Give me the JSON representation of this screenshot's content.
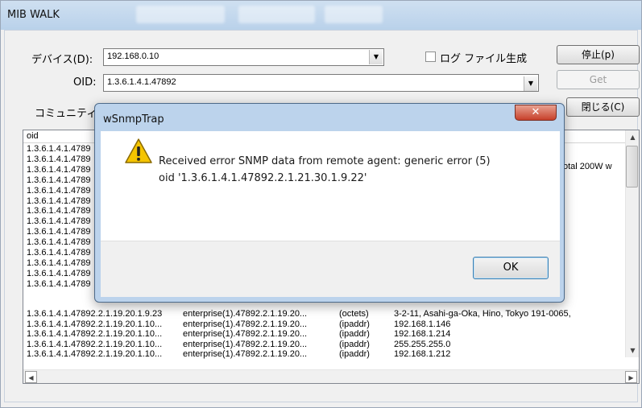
{
  "window": {
    "title": "MIB WALK"
  },
  "form": {
    "device_label": "デバイス(D):",
    "device_value": "192.168.0.10",
    "log_checkbox_label": "ログ ファイル生成",
    "log_checked": false,
    "oid_label": "OID:",
    "oid_value": "1.3.6.1.4.1.47892",
    "community_label": "コミュニティ",
    "stop_button": "停止(p)",
    "get_button": "Get",
    "close_button": "閉じる(C)"
  },
  "list": {
    "column_oid": "oid",
    "partial_right_text": "otal 200W w",
    "hidden_rows": [
      "1.3.6.1.4.1.4789",
      "1.3.6.1.4.1.4789",
      "1.3.6.1.4.1.4789",
      "1.3.6.1.4.1.4789",
      "1.3.6.1.4.1.4789",
      "1.3.6.1.4.1.4789",
      "1.3.6.1.4.1.4789",
      "1.3.6.1.4.1.4789",
      "1.3.6.1.4.1.4789",
      "1.3.6.1.4.1.4789",
      "1.3.6.1.4.1.4789",
      "1.3.6.1.4.1.4789",
      "1.3.6.1.4.1.4789",
      "1.3.6.1.4.1.4789"
    ],
    "rows": [
      {
        "oid": "1.3.6.1.4.1.47892.2.1.19.20.1.9.23",
        "name": "enterprise(1).47892.2.1.19.20...",
        "type": "(octets)",
        "value": "3-2-11, Asahi-ga-Oka, Hino, Tokyo 191-0065,"
      },
      {
        "oid": "1.3.6.1.4.1.47892.2.1.19.20.1.10...",
        "name": "enterprise(1).47892.2.1.19.20...",
        "type": "(ipaddr)",
        "value": "192.168.1.146"
      },
      {
        "oid": "1.3.6.1.4.1.47892.2.1.19.20.1.10...",
        "name": "enterprise(1).47892.2.1.19.20...",
        "type": "(ipaddr)",
        "value": "192.168.1.214"
      },
      {
        "oid": "1.3.6.1.4.1.47892.2.1.19.20.1.10...",
        "name": "enterprise(1).47892.2.1.19.20...",
        "type": "(ipaddr)",
        "value": "255.255.255.0"
      },
      {
        "oid": "1.3.6.1.4.1.47892.2.1.19.20.1.10...",
        "name": "enterprise(1).47892.2.1.19.20...",
        "type": "(ipaddr)",
        "value": "192.168.1.212"
      }
    ]
  },
  "dialog": {
    "title": "wSnmpTrap",
    "close_glyph": "✕",
    "message_line1": "Received error SNMP data from remote agent: generic error (5)",
    "message_line2": "oid '1.3.6.1.4.1.47892.2.1.21.30.1.9.22'",
    "ok_button": "OK",
    "icon": "warning-icon"
  },
  "colors": {
    "title_bar": "#b9d1ea",
    "dialog_close": "#c7402a",
    "warning": "#f5c400"
  }
}
